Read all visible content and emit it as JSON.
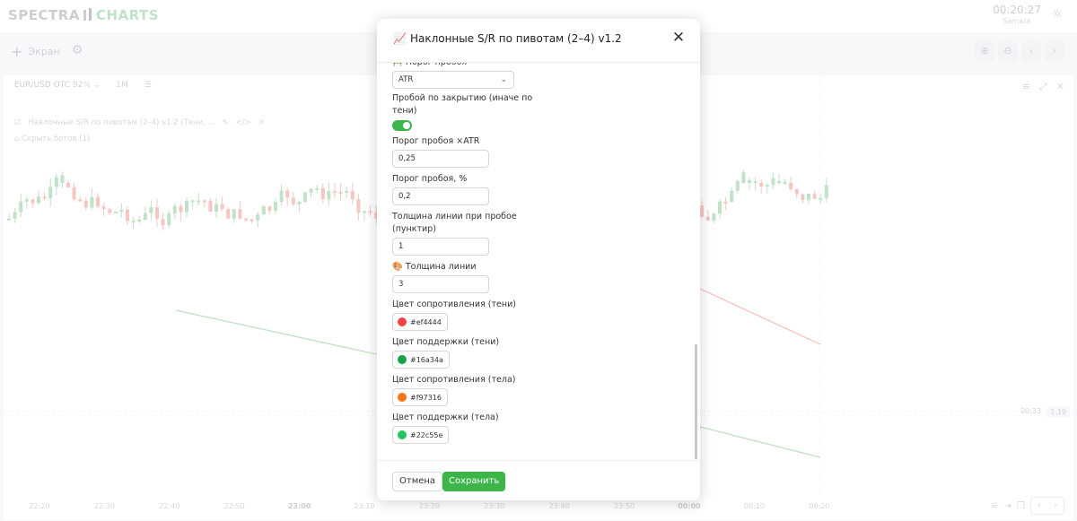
{
  "app": {
    "logo_left": "SPECTRA",
    "logo_right": "CHARTS",
    "time": "00:20:27",
    "city": "Samara"
  },
  "toolbar": {
    "screen_label": "Экран"
  },
  "chart_header": {
    "symbol": "EUR/USD OTC",
    "payout": "92%",
    "timeframe": "1M"
  },
  "indicator": {
    "label": "Наклонные S/R по пивотам (2–4) v1.2 (Тени, ..."
  },
  "bots": {
    "label": "Скрыть ботов (1)"
  },
  "chart_data": {
    "type": "candlestick",
    "x_ticks": [
      "22:20",
      "22:30",
      "22:40",
      "22:50",
      "23:00",
      "23:10",
      "23:20",
      "23:30",
      "23:40",
      "23:50",
      "00:00",
      "00:10",
      "00:20"
    ],
    "bold_ticks": [
      "23:00",
      "00:00"
    ],
    "current_price_label": "1.19",
    "countdown": "00:33",
    "series_colors": {
      "up": "#9ed3a8",
      "down": "#f1a9a0"
    }
  },
  "modal": {
    "title_icon": "📈",
    "title": "Наклонные S/R по пивотам (2–4) v1.2",
    "fields": {
      "breakout_threshold_label": "🚧 Порог пробоя",
      "breakout_threshold_value": "ATR",
      "close_breakout_label": "Пробой по закрытию (иначе по тени)",
      "close_breakout_on": true,
      "atr_mult_label": "Порог пробоя ×ATR",
      "atr_mult_value": "0,25",
      "pct_label": "Порог пробоя, %",
      "pct_value": "0,2",
      "break_width_label": "Толщина линии при пробое (пунктир)",
      "break_width_value": "1",
      "line_width_label": "🎨 Толщина линии",
      "line_width_value": "3",
      "res_wick_label": "Цвет сопротивления (тени)",
      "res_wick_color": "#ef4444",
      "sup_wick_label": "Цвет поддержки (тени)",
      "sup_wick_color": "#16a34a",
      "res_body_label": "Цвет сопротивления (тела)",
      "res_body_color": "#f97316",
      "sup_body_label": "Цвет поддержки (тела)",
      "sup_body_color": "#22c55e"
    },
    "cancel_label": "Отмена",
    "save_label": "Сохранить"
  }
}
